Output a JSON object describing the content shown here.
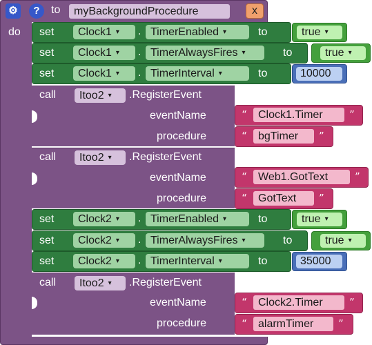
{
  "procedure": {
    "to_label": "to",
    "name": "myBackgroundProcedure",
    "close_label": "x",
    "do_label": "do",
    "help_glyph": "?"
  },
  "labels": {
    "set": "set",
    "to": "to",
    "dot": ".",
    "call": "call",
    "quote_open": "“",
    "quote_close": "”",
    "dropdown_arrow": "▾"
  },
  "rows": [
    {
      "component": "Clock1",
      "property": "TimerEnabled",
      "value": "true"
    },
    {
      "component": "Clock1",
      "property": "TimerAlwaysFires",
      "value": "true"
    },
    {
      "component": "Clock1",
      "property": "TimerInterval",
      "value": "10000"
    },
    {
      "component": "Clock2",
      "property": "TimerEnabled",
      "value": "true"
    },
    {
      "component": "Clock2",
      "property": "TimerAlwaysFires",
      "value": "true"
    },
    {
      "component": "Clock2",
      "property": "TimerInterval",
      "value": "35000"
    }
  ],
  "calls": [
    {
      "component": "Itoo2",
      "method": ".RegisterEvent",
      "arg1_label": "eventName",
      "arg1_value": "Clock1.Timer",
      "arg2_label": "procedure",
      "arg2_value": "bgTimer"
    },
    {
      "component": "Itoo2",
      "method": ".RegisterEvent",
      "arg1_label": "eventName",
      "arg1_value": "Web1.GotText",
      "arg2_label": "procedure",
      "arg2_value": "GotText"
    },
    {
      "component": "Itoo2",
      "method": ".RegisterEvent",
      "arg1_label": "eventName",
      "arg1_value": "Clock2.Timer",
      "arg2_label": "procedure",
      "arg2_value": "alarmTimer"
    }
  ],
  "colors": {
    "procedure": "#7c5386",
    "setter": "#2f7d3f",
    "boolean": "#44a03c",
    "number": "#4a6fb8",
    "text": "#c2366b"
  }
}
